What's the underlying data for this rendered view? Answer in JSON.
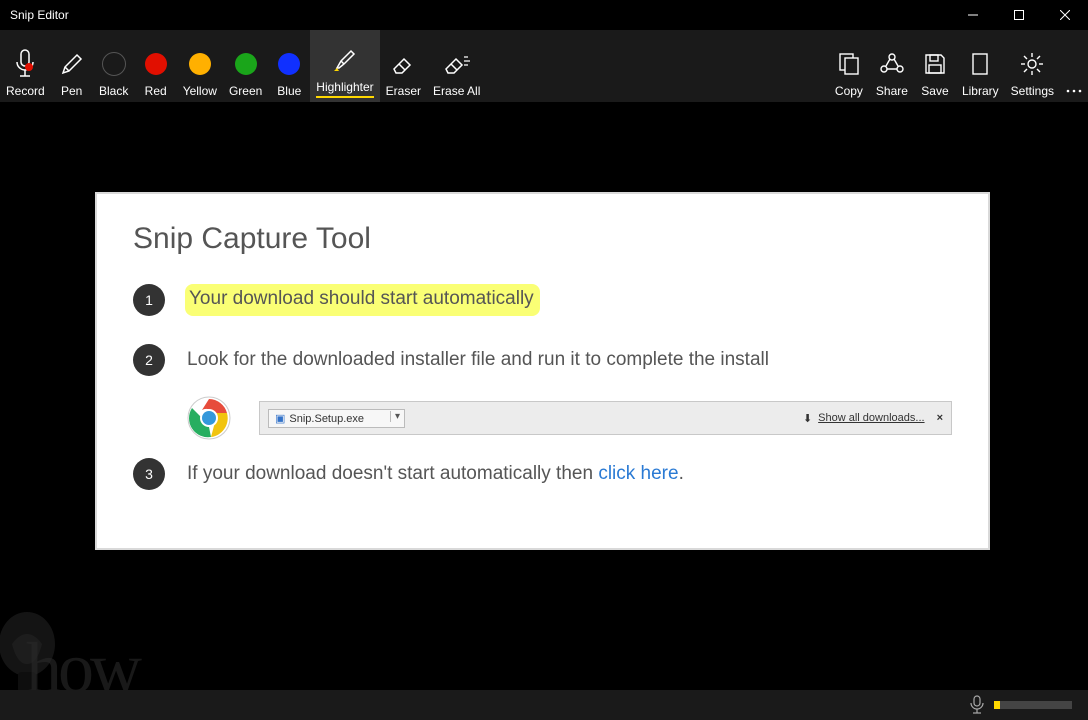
{
  "window": {
    "title": "Snip Editor"
  },
  "toolbar": {
    "record": "Record",
    "pen": "Pen",
    "black": "Black",
    "red": "Red",
    "yellow": "Yellow",
    "green": "Green",
    "blue": "Blue",
    "highlighter": "Highlighter",
    "eraser": "Eraser",
    "erase_all": "Erase All",
    "copy": "Copy",
    "share": "Share",
    "save": "Save",
    "library": "Library",
    "settings": "Settings",
    "colors": {
      "black": "#1a1a1a",
      "red": "#e10f00",
      "yellow": "#ffb000",
      "green": "#1aa51a",
      "blue": "#1030ff"
    }
  },
  "page": {
    "title": "Snip Capture Tool",
    "step1_text": "Your download should start automatically",
    "step2_text": "Look for the downloaded installer file and run it to complete the install",
    "step3_prefix": "If your download doesn't start automatically then ",
    "step3_link": "click here",
    "step3_suffix": ".",
    "download_file": "Snip.Setup.exe",
    "show_all": "Show all downloads...",
    "num1": "1",
    "num2": "2",
    "num3": "3"
  },
  "watermark": "how"
}
